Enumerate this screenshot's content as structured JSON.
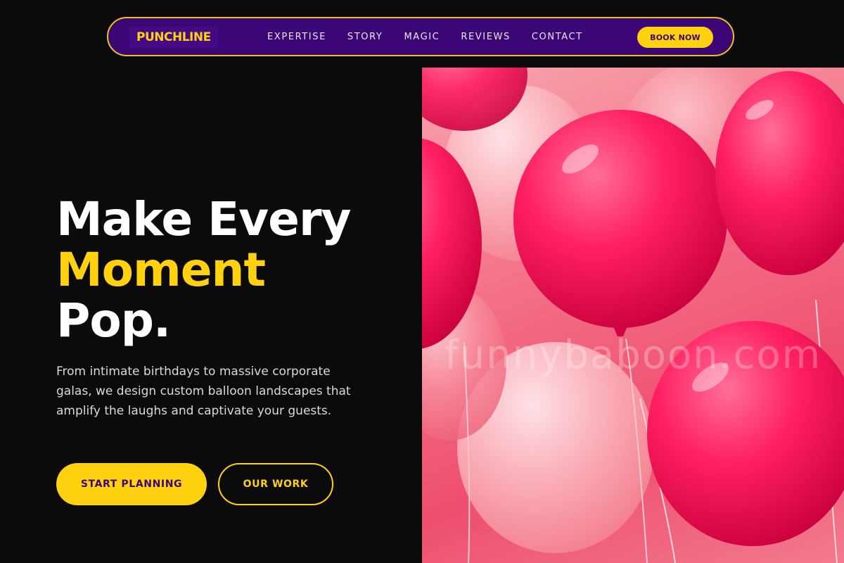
{
  "brand": {
    "logo_text": "PUNCHLINE"
  },
  "nav": {
    "links": [
      "EXPERTISE",
      "STORY",
      "MAGIC",
      "REVIEWS",
      "CONTACT"
    ],
    "book_label": "BOOK NOW"
  },
  "hero": {
    "title_line1": "Make Every",
    "title_line2": "Moment",
    "title_line3": "Pop.",
    "description": "From intimate birthdays to massive corporate galas, we design custom balloon landscapes that amplify the laughs and captivate your guests.",
    "primary_cta": "START PLANNING",
    "secondary_cta": "OUR WORK",
    "image_watermark": "funnybaboon.com"
  },
  "colors": {
    "background": "#0b0b0c",
    "nav_bg": "#3b0676",
    "accent_yellow": "#ffd10f",
    "balloon_pink": "#ff1f62"
  }
}
